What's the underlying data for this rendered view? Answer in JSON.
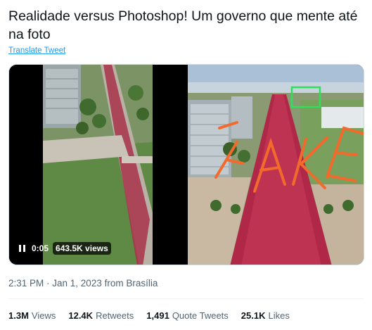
{
  "tweet": {
    "text": "Realidade versus Photoshop! Um governo que mente até na foto",
    "translate_label": "Translate Tweet"
  },
  "video": {
    "time": "0:05",
    "views": "643.5K views"
  },
  "photo": {
    "overlay_text": "FAKE"
  },
  "meta": {
    "timestamp": "2:31 PM · Jan 1, 2023 from Brasília"
  },
  "stats": {
    "views_count": "1.3M",
    "views_label": "Views",
    "retweets_count": "12.4K",
    "retweets_label": "Retweets",
    "quotes_count": "1,491",
    "quotes_label": "Quote Tweets",
    "likes_count": "25.1K",
    "likes_label": "Likes"
  }
}
